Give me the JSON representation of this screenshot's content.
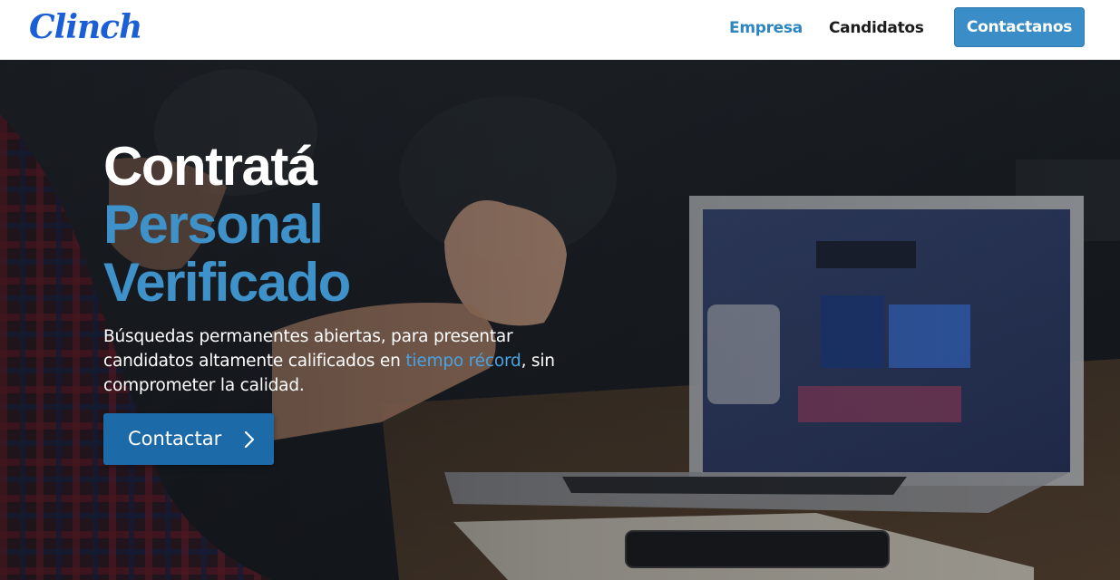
{
  "header": {
    "logo_text": "Clinch",
    "nav": {
      "empresa": "Empresa",
      "candidatos": "Candidatos"
    },
    "cta_label": "Contactanos"
  },
  "hero": {
    "headline": {
      "line1": "Contratá",
      "line2": "Personal",
      "line3": "Verificado"
    },
    "subtitle": {
      "part1": "Búsquedas permanentes abiertas, para presentar candidatos altamente calificados en ",
      "highlight": "tiempo récord",
      "part2": ", sin comprometer la calidad."
    },
    "button_label": "Contactar",
    "button_icon": "chevron-right-icon"
  },
  "colors": {
    "brand_blue": "#1a5fd6",
    "accent": "#3a8dc7",
    "headline_blue": "#3e92c9",
    "highlight": "#4aa3e0",
    "button_bg": "#1d6aa8"
  }
}
